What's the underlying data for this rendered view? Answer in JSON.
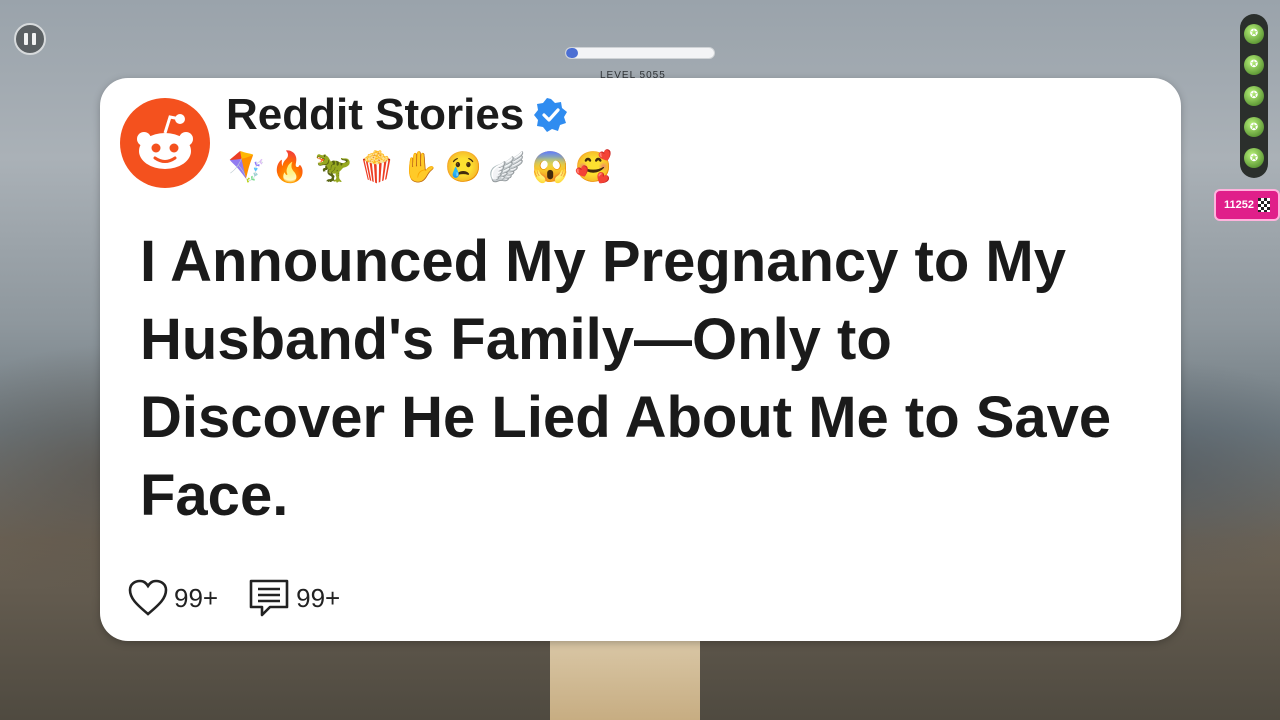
{
  "game": {
    "level_label": "LEVEL 5055",
    "progress": 0.08,
    "score": "11252"
  },
  "post": {
    "channel_name": "Reddit Stories",
    "emojis": "🪁🔥🦖🍿✋😢🪽😱🥰",
    "title": "I Announced My Pregnancy to My Husband's Family—Only to Discover He Lied About Me to Save Face.",
    "likes": "99+",
    "comments": "99+"
  },
  "colors": {
    "reddit_orange": "#f4511e",
    "verified_blue": "#2f8cf0",
    "score_badge": "#e01f8a",
    "progress_fill": "#4c6fd3"
  },
  "icons": [
    "pause-icon",
    "reddit-logo-icon",
    "verified-badge-icon",
    "heart-icon",
    "comment-icon",
    "soccer-ball-icon",
    "checkered-flag-icon"
  ]
}
